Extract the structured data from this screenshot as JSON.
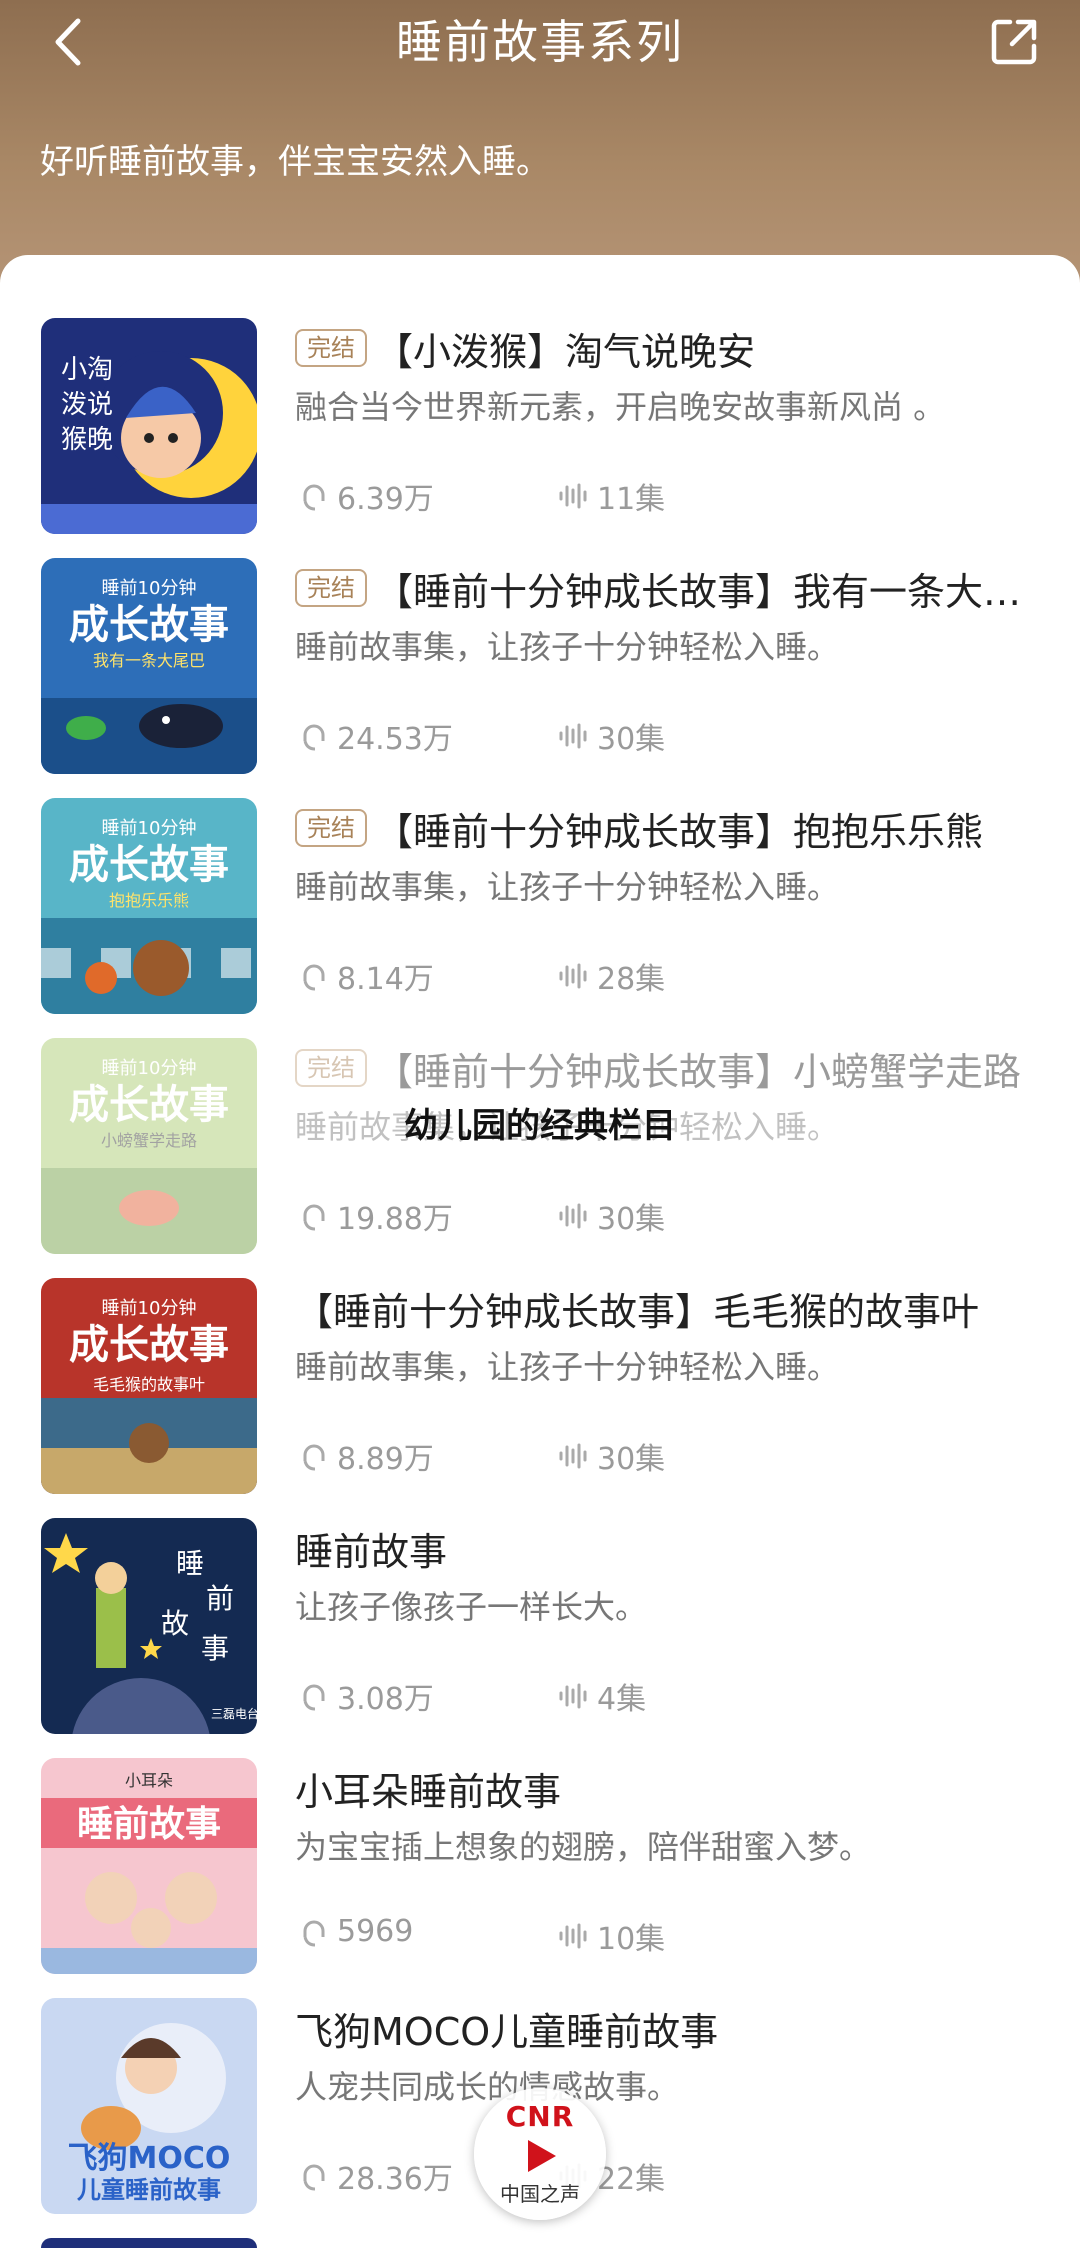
{
  "header": {
    "title": "睡前故事系列",
    "subtitle": "好听睡前故事，伴宝宝安然入睡。",
    "back_icon": "chevron-left-icon",
    "share_icon": "share-external-icon"
  },
  "items": [
    {
      "badge": "完结",
      "title": "【小泼猴】淘气说晚安",
      "desc": "融合当今世界新元素，开启晚安故事新风尚 。",
      "plays": "6.39万",
      "episodes": "11集",
      "cover_text": "小淘气泼猴说晚安"
    },
    {
      "badge": "完结",
      "title": "【睡前十分钟成长故事】我有一条大尾巴",
      "desc": "睡前故事集，让孩子十分钟轻松入睡。",
      "plays": "24.53万",
      "episodes": "30集",
      "cover_text": "成长故事",
      "cover_sub": "我有一条大尾巴",
      "cover_top": "睡前10分钟"
    },
    {
      "badge": "完结",
      "title": "【睡前十分钟成长故事】抱抱乐乐熊",
      "desc": "睡前故事集，让孩子十分钟轻松入睡。",
      "plays": "8.14万",
      "episodes": "28集",
      "cover_text": "成长故事",
      "cover_sub": "抱抱乐乐熊",
      "cover_top": "睡前10分钟"
    },
    {
      "badge": "完结",
      "title": "【睡前十分钟成长故事】小螃蟹学走路",
      "desc": "睡前故事集，让孩子十分钟轻松入睡。",
      "plays": "19.88万",
      "episodes": "30集",
      "cover_text": "成长故事",
      "cover_sub": "小螃蟹学走路",
      "cover_top": "睡前10分钟"
    },
    {
      "badge": "",
      "title": "【睡前十分钟成长故事】毛毛猴的故事叶",
      "desc": "睡前故事集，让孩子十分钟轻松入睡。",
      "plays": "8.89万",
      "episodes": "30集",
      "cover_text": "成长故事",
      "cover_sub": "毛毛猴的故事叶",
      "cover_top": "睡前10分钟"
    },
    {
      "badge": "",
      "title": "睡前故事",
      "desc": "让孩子像孩子一样长大。",
      "plays": "3.08万",
      "episodes": "4集",
      "cover_text": "睡前故事",
      "cover_sub": "三磊电台"
    },
    {
      "badge": "",
      "title": "小耳朵睡前故事",
      "desc": "为宝宝插上想象的翅膀，陪伴甜蜜入梦。",
      "plays": "5969",
      "episodes": "10集",
      "cover_text": "睡前故事",
      "cover_top": "小耳朵"
    },
    {
      "badge": "",
      "title": "飞狗MOCO儿童睡前故事",
      "desc": "人宠共同成长的情感故事。",
      "plays": "28.36万",
      "episodes": "22集",
      "cover_text": "飞狗MOCO",
      "cover_sub": "儿童睡前故事"
    }
  ],
  "overlay_caption": "幼儿园的经典栏目",
  "watermark": {
    "brand": "CNR",
    "name": "中国之声"
  },
  "colors": {
    "header": "#a98866",
    "badge": "#c4a583",
    "muted": "#9a9a9a"
  }
}
